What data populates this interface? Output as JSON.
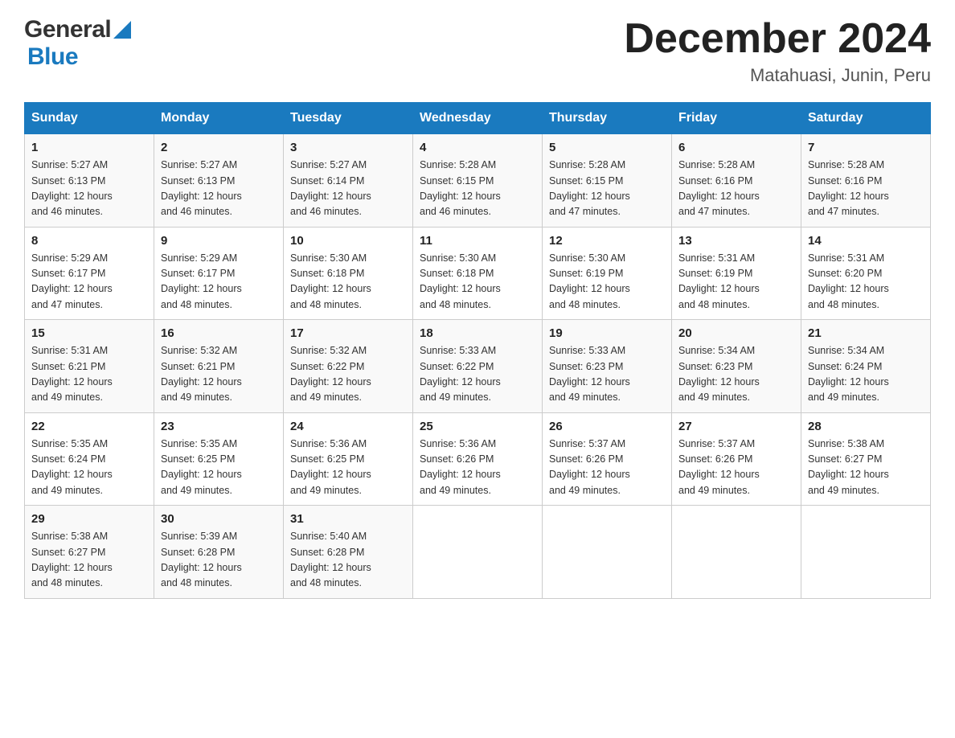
{
  "header": {
    "logo_general": "General",
    "logo_blue": "Blue",
    "title": "December 2024",
    "subtitle": "Matahuasi, Junin, Peru"
  },
  "calendar": {
    "headers": [
      "Sunday",
      "Monday",
      "Tuesday",
      "Wednesday",
      "Thursday",
      "Friday",
      "Saturday"
    ],
    "weeks": [
      [
        {
          "day": "1",
          "info": "Sunrise: 5:27 AM\nSunset: 6:13 PM\nDaylight: 12 hours\nand 46 minutes."
        },
        {
          "day": "2",
          "info": "Sunrise: 5:27 AM\nSunset: 6:13 PM\nDaylight: 12 hours\nand 46 minutes."
        },
        {
          "day": "3",
          "info": "Sunrise: 5:27 AM\nSunset: 6:14 PM\nDaylight: 12 hours\nand 46 minutes."
        },
        {
          "day": "4",
          "info": "Sunrise: 5:28 AM\nSunset: 6:15 PM\nDaylight: 12 hours\nand 46 minutes."
        },
        {
          "day": "5",
          "info": "Sunrise: 5:28 AM\nSunset: 6:15 PM\nDaylight: 12 hours\nand 47 minutes."
        },
        {
          "day": "6",
          "info": "Sunrise: 5:28 AM\nSunset: 6:16 PM\nDaylight: 12 hours\nand 47 minutes."
        },
        {
          "day": "7",
          "info": "Sunrise: 5:28 AM\nSunset: 6:16 PM\nDaylight: 12 hours\nand 47 minutes."
        }
      ],
      [
        {
          "day": "8",
          "info": "Sunrise: 5:29 AM\nSunset: 6:17 PM\nDaylight: 12 hours\nand 47 minutes."
        },
        {
          "day": "9",
          "info": "Sunrise: 5:29 AM\nSunset: 6:17 PM\nDaylight: 12 hours\nand 48 minutes."
        },
        {
          "day": "10",
          "info": "Sunrise: 5:30 AM\nSunset: 6:18 PM\nDaylight: 12 hours\nand 48 minutes."
        },
        {
          "day": "11",
          "info": "Sunrise: 5:30 AM\nSunset: 6:18 PM\nDaylight: 12 hours\nand 48 minutes."
        },
        {
          "day": "12",
          "info": "Sunrise: 5:30 AM\nSunset: 6:19 PM\nDaylight: 12 hours\nand 48 minutes."
        },
        {
          "day": "13",
          "info": "Sunrise: 5:31 AM\nSunset: 6:19 PM\nDaylight: 12 hours\nand 48 minutes."
        },
        {
          "day": "14",
          "info": "Sunrise: 5:31 AM\nSunset: 6:20 PM\nDaylight: 12 hours\nand 48 minutes."
        }
      ],
      [
        {
          "day": "15",
          "info": "Sunrise: 5:31 AM\nSunset: 6:21 PM\nDaylight: 12 hours\nand 49 minutes."
        },
        {
          "day": "16",
          "info": "Sunrise: 5:32 AM\nSunset: 6:21 PM\nDaylight: 12 hours\nand 49 minutes."
        },
        {
          "day": "17",
          "info": "Sunrise: 5:32 AM\nSunset: 6:22 PM\nDaylight: 12 hours\nand 49 minutes."
        },
        {
          "day": "18",
          "info": "Sunrise: 5:33 AM\nSunset: 6:22 PM\nDaylight: 12 hours\nand 49 minutes."
        },
        {
          "day": "19",
          "info": "Sunrise: 5:33 AM\nSunset: 6:23 PM\nDaylight: 12 hours\nand 49 minutes."
        },
        {
          "day": "20",
          "info": "Sunrise: 5:34 AM\nSunset: 6:23 PM\nDaylight: 12 hours\nand 49 minutes."
        },
        {
          "day": "21",
          "info": "Sunrise: 5:34 AM\nSunset: 6:24 PM\nDaylight: 12 hours\nand 49 minutes."
        }
      ],
      [
        {
          "day": "22",
          "info": "Sunrise: 5:35 AM\nSunset: 6:24 PM\nDaylight: 12 hours\nand 49 minutes."
        },
        {
          "day": "23",
          "info": "Sunrise: 5:35 AM\nSunset: 6:25 PM\nDaylight: 12 hours\nand 49 minutes."
        },
        {
          "day": "24",
          "info": "Sunrise: 5:36 AM\nSunset: 6:25 PM\nDaylight: 12 hours\nand 49 minutes."
        },
        {
          "day": "25",
          "info": "Sunrise: 5:36 AM\nSunset: 6:26 PM\nDaylight: 12 hours\nand 49 minutes."
        },
        {
          "day": "26",
          "info": "Sunrise: 5:37 AM\nSunset: 6:26 PM\nDaylight: 12 hours\nand 49 minutes."
        },
        {
          "day": "27",
          "info": "Sunrise: 5:37 AM\nSunset: 6:26 PM\nDaylight: 12 hours\nand 49 minutes."
        },
        {
          "day": "28",
          "info": "Sunrise: 5:38 AM\nSunset: 6:27 PM\nDaylight: 12 hours\nand 49 minutes."
        }
      ],
      [
        {
          "day": "29",
          "info": "Sunrise: 5:38 AM\nSunset: 6:27 PM\nDaylight: 12 hours\nand 48 minutes."
        },
        {
          "day": "30",
          "info": "Sunrise: 5:39 AM\nSunset: 6:28 PM\nDaylight: 12 hours\nand 48 minutes."
        },
        {
          "day": "31",
          "info": "Sunrise: 5:40 AM\nSunset: 6:28 PM\nDaylight: 12 hours\nand 48 minutes."
        },
        {
          "day": "",
          "info": ""
        },
        {
          "day": "",
          "info": ""
        },
        {
          "day": "",
          "info": ""
        },
        {
          "day": "",
          "info": ""
        }
      ]
    ]
  }
}
